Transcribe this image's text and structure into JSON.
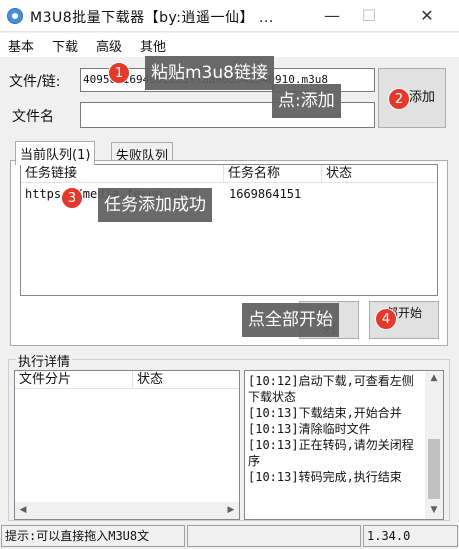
{
  "window": {
    "title": "M3U8批量下载器【by:逍遥一仙】 ...",
    "min": "—",
    "max": "☐",
    "close": "✕"
  },
  "menu": [
    "基本",
    "下载",
    "高级",
    "其他"
  ],
  "form": {
    "file_label": "文件/链:",
    "file_value": "409561169490cb83ffaa603542540910.m3u8",
    "name_label": "文件名",
    "name_value": "",
    "add_button": "添加"
  },
  "tabs": [
    "当前队列(1)",
    "失败队列"
  ],
  "queue": {
    "columns": [
      "任务链接",
      "任务名称",
      "状态"
    ],
    "rows": [
      {
        "link": "https://media.fexue.com/",
        "name": "1669864151",
        "status": ""
      }
    ]
  },
  "buttons": {
    "left_small": "列",
    "start_all": "部开始"
  },
  "details": {
    "title": "执行详情",
    "columns": [
      "文件分片",
      "状态"
    ],
    "log": [
      "[10:12]启动下载,可查看左侧下载状态",
      "[10:13]下载结束,开始合并",
      "[10:13]清除临时文件",
      "[10:13]正在转码,请勿关闭程序",
      "[10:13]转码完成,执行结束"
    ]
  },
  "status": {
    "hint": "提示:可以直接拖入M3U8文",
    "version": "1.34.0"
  },
  "annotations": [
    {
      "number": "1",
      "text": "粘贴m3u8链接"
    },
    {
      "number": "2",
      "text": "点:添加"
    },
    {
      "number": "3",
      "text": "任务添加成功"
    },
    {
      "number": "4",
      "text": "点全部开始"
    }
  ],
  "colors": {
    "badge": "#e43a2d",
    "callout": "#5f5f5f"
  }
}
